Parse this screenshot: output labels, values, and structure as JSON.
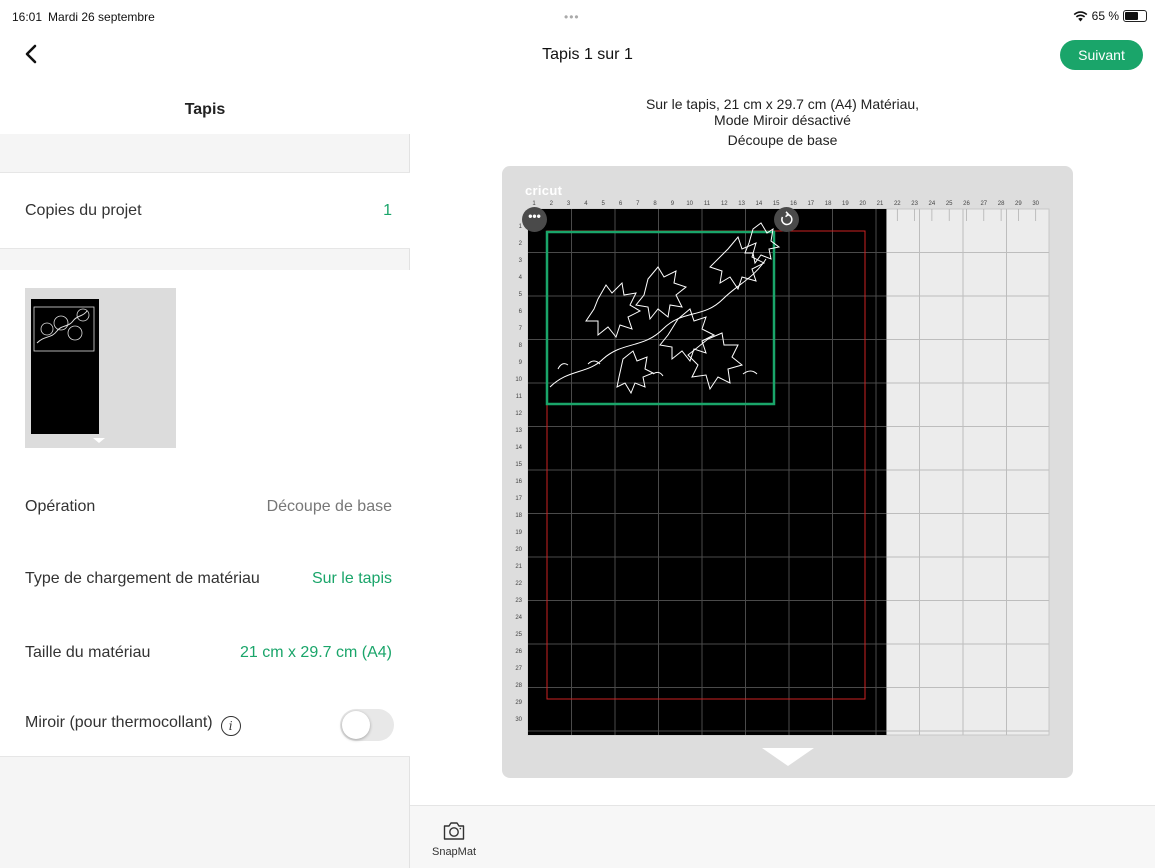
{
  "status_bar": {
    "time": "16:01",
    "date": "Mardi 26 septembre",
    "dots": "•••",
    "battery": "65 %",
    "battery_level_percent": 65
  },
  "nav": {
    "title": "Tapis 1 sur 1",
    "next_label": "Suivant",
    "back_icon": "chevron-left-icon"
  },
  "left_panel": {
    "title": "Tapis",
    "copies": {
      "label": "Copies du projet",
      "value": "1"
    },
    "operation": {
      "label": "Opération",
      "value": "Découpe de base"
    },
    "load_type": {
      "label": "Type de chargement de matériau",
      "value": "Sur le tapis"
    },
    "material_size": {
      "label": "Taille du matériau",
      "value": "21 cm x 29.7 cm (A4)"
    },
    "mirror": {
      "label": "Miroir (pour thermocollant)",
      "info_glyph": "i",
      "enabled": false
    }
  },
  "preview": {
    "line1": "Sur le tapis, 21 cm x 29.7 cm (A4) Matériau,",
    "line2": "Mode Miroir désactivé",
    "operation": "Découpe de base",
    "mat_logo": "cricut",
    "menu_glyph": "•••",
    "top_ruler": [
      "1",
      "2",
      "3",
      "4",
      "5",
      "6",
      "7",
      "8",
      "9",
      "10",
      "11",
      "12",
      "13",
      "14",
      "15",
      "16",
      "17",
      "18",
      "19",
      "20",
      "21",
      "22",
      "23",
      "24",
      "25",
      "26",
      "27",
      "28",
      "29",
      "30"
    ],
    "side_ruler": [
      "1",
      "2",
      "3",
      "4",
      "5",
      "6",
      "7",
      "8",
      "9",
      "10",
      "11",
      "12",
      "13",
      "14",
      "15",
      "16",
      "17",
      "18",
      "19",
      "20",
      "21",
      "22",
      "23",
      "24",
      "25",
      "26",
      "27",
      "28",
      "29",
      "30"
    ]
  },
  "toolbar": {
    "snapmat_label": "SnapMat",
    "snapmat_icon": "camera-icon"
  },
  "colors": {
    "accent": "#1aa56a",
    "mat_bg": "#dddddd",
    "material": "#000000",
    "cut_line": "#ffffff",
    "margin_line": "#cc2222"
  }
}
